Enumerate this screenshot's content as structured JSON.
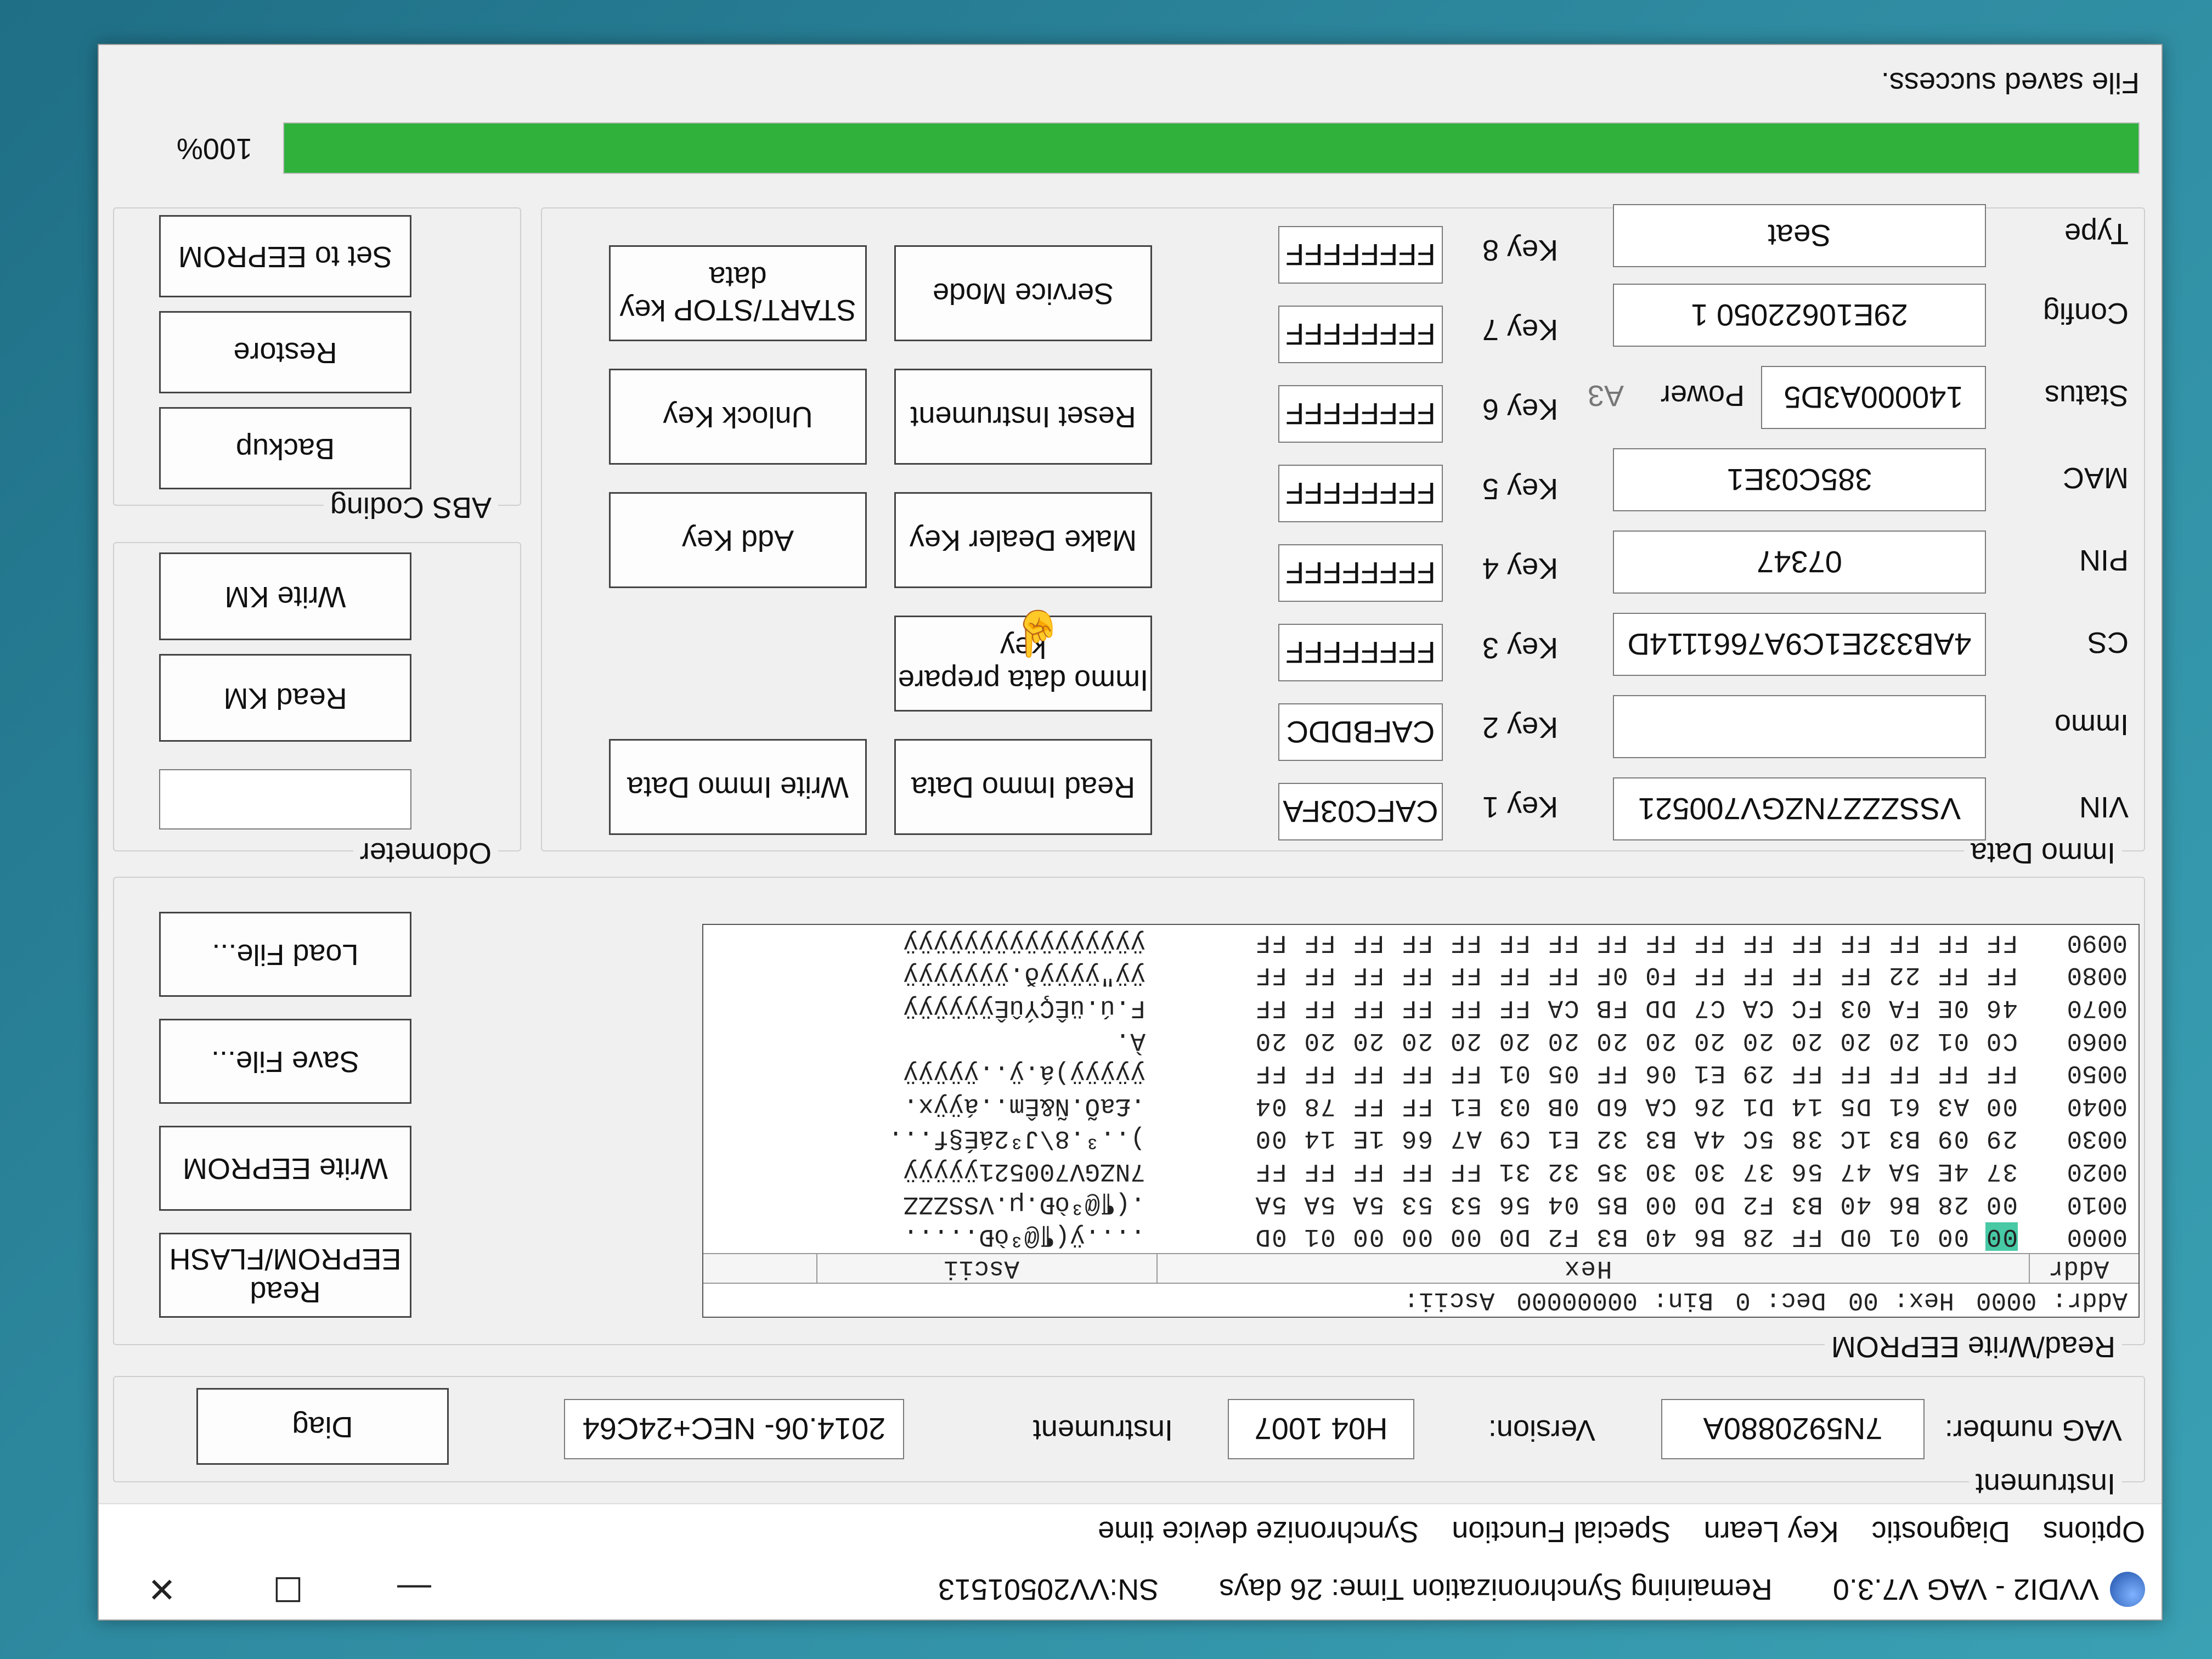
{
  "window": {
    "title": "VVDI2 - VAG V7.3.0",
    "sync_remaining": "Remaining Synchronization Time: 26 days",
    "serial": "SN:VV20501513",
    "minimize_glyph": "—",
    "maximize_glyph": "☐",
    "close_glyph": "✕"
  },
  "menu": [
    "Options",
    "Diagnostic",
    "Key Learn",
    "Special Function",
    "Synchronize device time"
  ],
  "instrument": {
    "group_label": "Instrument",
    "vag_number_label": "VAG number:",
    "vag_number": "7N5920880A",
    "version_label": "Version:",
    "version": "H04 1007",
    "instrument_label": "Instrument",
    "instrument_value": "2014.06- NEC+24C64",
    "diag_button": "Diag"
  },
  "eeprom": {
    "group_label": "Read/Write EEPROM",
    "status": {
      "addr": "Addr: 0000",
      "hex": "Hex: 00",
      "dec": "Dec: 0",
      "bin": "Bin: 00000000",
      "ascii": "Ascii:"
    },
    "columns": {
      "addr": "Addr",
      "hex": "Hex",
      "ascii": "Ascii"
    },
    "rows": [
      {
        "addr": "0000",
        "first": "00",
        "hex": " 00 01 0D FF 28 B6 40 B3 F2 D0 00 00 00 01 0D",
        "ascii": "....ÿ(¶@³òÐ....."
      },
      {
        "addr": "0010",
        "first": "",
        "hex": "00 28 B6 40 B3 F2 D0 00 B5 04 56 53 53 5A 5A 5A",
        "ascii": ".(¶@³òÐ.µ.VSSZZZ"
      },
      {
        "addr": "0020",
        "first": "",
        "hex": "37 4E 5A 47 56 37 30 30 35 32 31 FF FF FF FF FF",
        "ascii": "7NZGV700521ÿÿÿÿÿ"
      },
      {
        "addr": "0030",
        "first": "",
        "hex": "29 09 B3 1C 38 5C 4A B3 32 E1 C9 A7 66 1E 14 00",
        "ascii": ")..³.8\\J³2áÉ§f..."
      },
      {
        "addr": "0040",
        "first": "",
        "hex": "00 A3 61 D5 14 D1 26 CA 6D 0B 03 E1 FF FF 78 04",
        "ascii": ".£aÕ.Ñ&Êm..áÿÿx."
      },
      {
        "addr": "0050",
        "first": "",
        "hex": "FF FF FF FF FF 29 E1 06 FF 05 01 FF FF FF FF FF",
        "ascii": "ÿÿÿÿÿ)á.ÿ..ÿÿÿÿÿ"
      },
      {
        "addr": "0060",
        "first": "",
        "hex": "C0 01 20 20 20 20 20 20 20 20 20 20 20 20 20 20",
        "ascii": "À.              "
      },
      {
        "addr": "0070",
        "first": "",
        "hex": "46 0E FA 03 FC CA C7 DD FB CA FF FF FF FF FF FF",
        "ascii": "F.ú.üÊÇÝûÊÿÿÿÿÿÿ"
      },
      {
        "addr": "0080",
        "first": "",
        "hex": "FF FF 22 FF FF FF FF F0 0F FF FF FF FF FF FF FF",
        "ascii": "ÿÿ\"ÿÿÿÿð.ÿÿÿÿÿÿÿ"
      },
      {
        "addr": "0090",
        "first": "",
        "hex": "FF FF FF FF FF FF FF FF FF FF FF FF FF FF FF FF",
        "ascii": "ÿÿÿÿÿÿÿÿÿÿÿÿÿÿÿÿ"
      }
    ],
    "buttons": {
      "read": "Read EEPROM/FLASH",
      "write": "Write EEPROM",
      "save": "Save File...",
      "load": "Load File..."
    }
  },
  "immo": {
    "group_label": "Immo Data",
    "vin_label": "VIN",
    "vin": "VSSZZZ7NZGV700521",
    "immo_label": "Immo",
    "immo": "",
    "cs_label": "CS",
    "cs": "4AB332E1C9A7661114D",
    "pin_label": "PIN",
    "pin": "07347",
    "mac_label": "MAC",
    "mac": "385C03E1",
    "status_label": "Status",
    "status": "140000A3D5",
    "power_label": "Power",
    "power_value": "A3",
    "config_label": "Config",
    "config": "29E10622050 1",
    "type_label": "Type",
    "type": "Seat",
    "keys": [
      {
        "label": "Key 1",
        "value": "CAFC03FA"
      },
      {
        "label": "Key 2",
        "value": "CAFBDDC"
      },
      {
        "label": "Key 3",
        "value": "FFFFFFFF"
      },
      {
        "label": "Key 4",
        "value": "FFFFFFFF"
      },
      {
        "label": "Key 5",
        "value": "FFFFFFFF"
      },
      {
        "label": "Key 6",
        "value": "FFFFFFFF"
      },
      {
        "label": "Key 7",
        "value": "FFFFFFFF"
      },
      {
        "label": "Key 8",
        "value": "FFFFFFFF"
      }
    ],
    "buttons": {
      "read_immo": "Read Immo Data",
      "write_immo": "Write Immo Data",
      "prepare_key": "Immo data prepare key",
      "make_dealer": "Make Dealer Key",
      "add_key": "Add Key",
      "reset_instrument": "Reset Instrument",
      "unlock_key": "Unlock Key",
      "service_mode": "Service Mode",
      "start_stop": "START/STOP key data"
    }
  },
  "odometer": {
    "group_label": "Odometer",
    "value": "",
    "read_km": "Read KM",
    "write_km": "Write KM"
  },
  "abs": {
    "group_label": "ABS Coding",
    "backup": "Backup",
    "restore": "Restore",
    "set_eeprom": "Set to EEPROM"
  },
  "progress": {
    "percent": 100,
    "label": "100%"
  },
  "status_message": "File saved success.",
  "colors": {
    "progress": "#2fb13c",
    "highlight": "#47c9a5"
  }
}
